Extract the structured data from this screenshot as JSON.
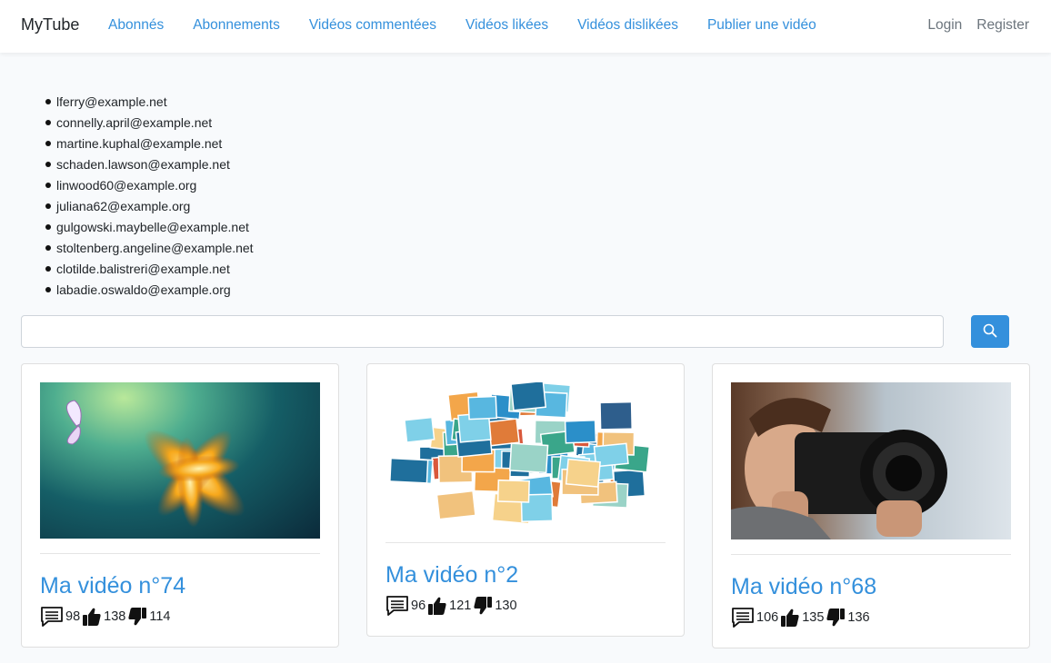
{
  "nav": {
    "brand": "MyTube",
    "links": [
      "Abonnés",
      "Abonnements",
      "Vidéos commentées",
      "Vidéos likées",
      "Vidéos dislikées",
      "Publier une vidéo"
    ],
    "right": [
      "Login",
      "Register"
    ]
  },
  "emails": [
    "lferry@example.net",
    "connelly.april@example.net",
    "martine.kuphal@example.net",
    "schaden.lawson@example.net",
    "linwood60@example.org",
    "juliana62@example.org",
    "gulgowski.maybelle@example.net",
    "stoltenberg.angeline@example.net",
    "clotilde.balistreri@example.net",
    "labadie.oswaldo@example.org"
  ],
  "search": {
    "value": "",
    "placeholder": "",
    "button_icon": "search-icon"
  },
  "videos": [
    {
      "title": "Ma vidéo n°74",
      "comments": "98",
      "likes": "138",
      "dislikes": "114",
      "thumbnail": "butterfly-flower-image"
    },
    {
      "title": "Ma vidéo n°2",
      "comments": "96",
      "likes": "121",
      "dislikes": "130",
      "thumbnail": "beach-collage-image"
    },
    {
      "title": "Ma vidéo n°68",
      "comments": "106",
      "likes": "135",
      "dislikes": "136",
      "thumbnail": "photographer-camera-image"
    }
  ],
  "colors": {
    "accent": "#3490dc",
    "muted": "#6c757d"
  }
}
